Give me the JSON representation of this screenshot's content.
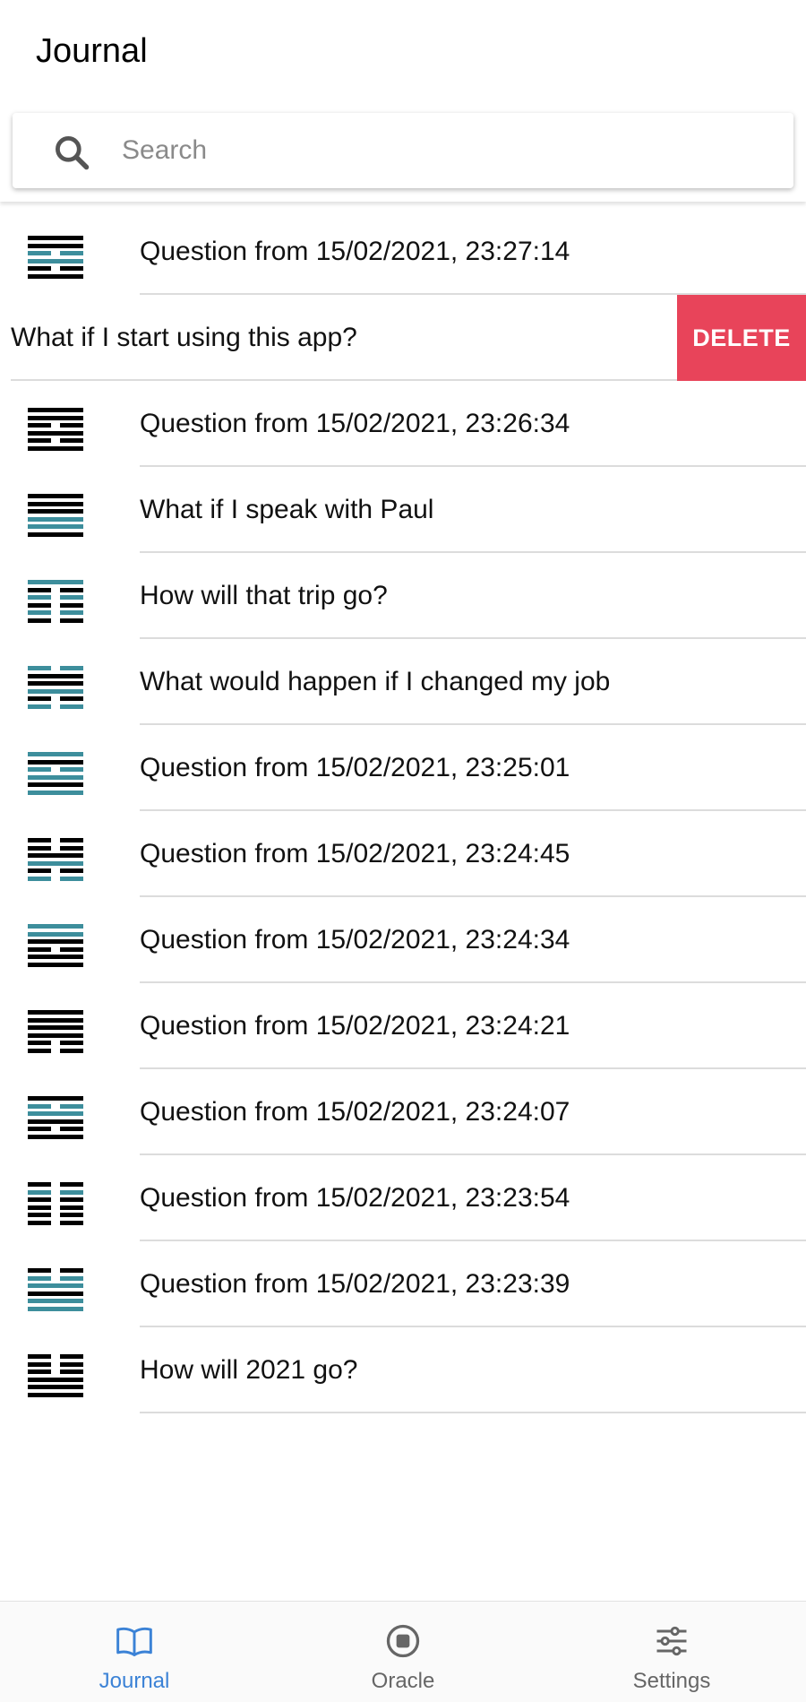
{
  "header": {
    "title": "Journal"
  },
  "search": {
    "placeholder": "Search",
    "icon": "search-icon"
  },
  "colors": {
    "accent": "#3b82d6",
    "yin_yang_teal": "#3d8e9c",
    "delete": "#e8445a",
    "line": "#000000"
  },
  "entries": [
    {
      "label": "Question from 15/02/2021, 23:27:14",
      "hexagram": [
        [
          1,
          "k"
        ],
        [
          1,
          "k"
        ],
        [
          0,
          "t"
        ],
        [
          1,
          "t"
        ],
        [
          0,
          "k"
        ],
        [
          1,
          "k"
        ]
      ]
    },
    {
      "label": "What if I start using this app?",
      "swiped": true,
      "delete_label": "DELETE"
    },
    {
      "label": "Question from 15/02/2021, 23:26:34",
      "hexagram": [
        [
          1,
          "k"
        ],
        [
          1,
          "k"
        ],
        [
          0,
          "k"
        ],
        [
          1,
          "k"
        ],
        [
          0,
          "k"
        ],
        [
          1,
          "k"
        ]
      ]
    },
    {
      "label": "What if I speak with Paul",
      "hexagram": [
        [
          1,
          "k"
        ],
        [
          1,
          "k"
        ],
        [
          1,
          "k"
        ],
        [
          1,
          "t"
        ],
        [
          1,
          "t"
        ],
        [
          1,
          "k"
        ]
      ]
    },
    {
      "label": "How will that trip go?",
      "hexagram": [
        [
          1,
          "t"
        ],
        [
          0,
          "k"
        ],
        [
          0,
          "t"
        ],
        [
          0,
          "k"
        ],
        [
          0,
          "t"
        ],
        [
          0,
          "k"
        ]
      ]
    },
    {
      "label": "What would happen if I changed my job",
      "hexagram": [
        [
          0,
          "t"
        ],
        [
          1,
          "k"
        ],
        [
          1,
          "k"
        ],
        [
          1,
          "t"
        ],
        [
          0,
          "k"
        ],
        [
          0,
          "t"
        ]
      ]
    },
    {
      "label": "Question from 15/02/2021, 23:25:01",
      "hexagram": [
        [
          1,
          "t"
        ],
        [
          1,
          "k"
        ],
        [
          0,
          "t"
        ],
        [
          1,
          "t"
        ],
        [
          1,
          "k"
        ],
        [
          1,
          "t"
        ]
      ]
    },
    {
      "label": "Question from 15/02/2021, 23:24:45",
      "hexagram": [
        [
          0,
          "k"
        ],
        [
          0,
          "k"
        ],
        [
          1,
          "k"
        ],
        [
          1,
          "t"
        ],
        [
          0,
          "k"
        ],
        [
          0,
          "t"
        ]
      ]
    },
    {
      "label": "Question from 15/02/2021, 23:24:34",
      "hexagram": [
        [
          1,
          "t"
        ],
        [
          1,
          "t"
        ],
        [
          1,
          "k"
        ],
        [
          0,
          "k"
        ],
        [
          1,
          "k"
        ],
        [
          1,
          "k"
        ]
      ]
    },
    {
      "label": "Question from 15/02/2021, 23:24:21",
      "hexagram": [
        [
          1,
          "k"
        ],
        [
          1,
          "k"
        ],
        [
          1,
          "k"
        ],
        [
          1,
          "k"
        ],
        [
          0,
          "k"
        ],
        [
          0,
          "k"
        ]
      ]
    },
    {
      "label": "Question from 15/02/2021, 23:24:07",
      "hexagram": [
        [
          1,
          "k"
        ],
        [
          0,
          "t"
        ],
        [
          1,
          "t"
        ],
        [
          1,
          "k"
        ],
        [
          0,
          "k"
        ],
        [
          1,
          "k"
        ]
      ]
    },
    {
      "label": "Question from 15/02/2021, 23:23:54",
      "hexagram": [
        [
          0,
          "k"
        ],
        [
          0,
          "t"
        ],
        [
          0,
          "k"
        ],
        [
          0,
          "k"
        ],
        [
          0,
          "k"
        ],
        [
          0,
          "k"
        ]
      ]
    },
    {
      "label": "Question from 15/02/2021, 23:23:39",
      "hexagram": [
        [
          0,
          "k"
        ],
        [
          0,
          "t"
        ],
        [
          1,
          "t"
        ],
        [
          1,
          "k"
        ],
        [
          1,
          "t"
        ],
        [
          1,
          "t"
        ]
      ]
    },
    {
      "label": "How will 2021 go?",
      "hexagram": [
        [
          0,
          "k"
        ],
        [
          0,
          "k"
        ],
        [
          0,
          "k"
        ],
        [
          1,
          "k"
        ],
        [
          1,
          "k"
        ],
        [
          1,
          "k"
        ]
      ]
    }
  ],
  "tabs": [
    {
      "label": "Journal",
      "icon": "book-icon",
      "active": true
    },
    {
      "label": "Oracle",
      "icon": "oracle-icon",
      "active": false
    },
    {
      "label": "Settings",
      "icon": "sliders-icon",
      "active": false
    }
  ]
}
